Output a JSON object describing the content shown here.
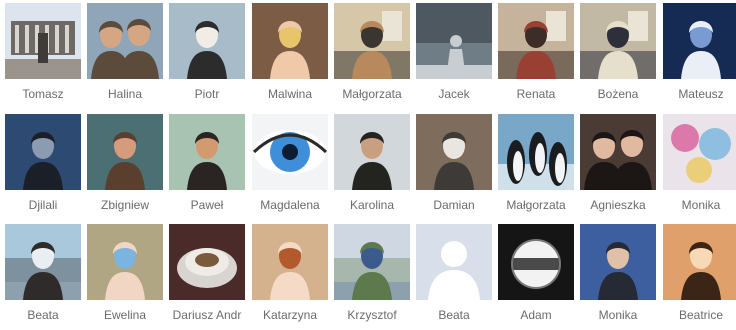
{
  "friends": [
    {
      "name": "Tomasz",
      "thumb": "monument-square",
      "colors": [
        "#dce4ee",
        "#6d6a66",
        "#3e3b38"
      ]
    },
    {
      "name": "Halina",
      "thumb": "couple-selfie",
      "colors": [
        "#8fa6b8",
        "#d5a684",
        "#5c4a3b"
      ]
    },
    {
      "name": "Piotr",
      "thumb": "man-sunglasses",
      "colors": [
        "#a7bcc8",
        "#f2ece6",
        "#2c2c2c"
      ]
    },
    {
      "name": "Malwina",
      "thumb": "blonde-woman",
      "colors": [
        "#7c5c45",
        "#e8c56d",
        "#f0c9a8"
      ]
    },
    {
      "name": "Małgorzata",
      "thumb": "woman-in-room",
      "colors": [
        "#d6c7a9",
        "#3a3530",
        "#b7895c"
      ]
    },
    {
      "name": "Jacek",
      "thumb": "silhouette-sky",
      "colors": [
        "#6f7d87",
        "#1d1f22",
        "#c8cdd1"
      ]
    },
    {
      "name": "Renata",
      "thumb": "woman-desk",
      "colors": [
        "#c6b39c",
        "#3c2d28",
        "#9a4032"
      ]
    },
    {
      "name": "Bożena",
      "thumb": "room-interior",
      "colors": [
        "#c2b9a4",
        "#2d2f3b",
        "#e5dfcc"
      ]
    },
    {
      "name": "Mateusz",
      "thumb": "blue-portrait",
      "colors": [
        "#162b54",
        "#7a9ad2",
        "#e9eef7"
      ]
    },
    {
      "name": "Djilali",
      "thumb": "man-blue-room",
      "colors": [
        "#2d4a72",
        "#8a9bb2",
        "#1a1f28"
      ]
    },
    {
      "name": "Zbigniew",
      "thumb": "man-face",
      "colors": [
        "#4b6f72",
        "#d49b7c",
        "#5b3f2e"
      ]
    },
    {
      "name": "Paweł",
      "thumb": "young-man",
      "colors": [
        "#a8c3b1",
        "#d3996f",
        "#2a2522"
      ]
    },
    {
      "name": "Magdalena",
      "thumb": "blue-eye",
      "colors": [
        "#f2f4f6",
        "#3f8ed8",
        "#0b1c33"
      ]
    },
    {
      "name": "Karolina",
      "thumb": "young-man-dark",
      "colors": [
        "#d2d7dc",
        "#c9a07f",
        "#23231f"
      ]
    },
    {
      "name": "Damian",
      "thumb": "man-striped-shirt",
      "colors": [
        "#7e6d5c",
        "#e9e6e1",
        "#3d3a37"
      ]
    },
    {
      "name": "Małgorzata",
      "thumb": "penguins",
      "colors": [
        "#78a7c8",
        "#1a1c1f",
        "#f2f4f5"
      ]
    },
    {
      "name": "Agnieszka",
      "thumb": "couple-dark",
      "colors": [
        "#4a3c35",
        "#e0b9a0",
        "#1c1614"
      ]
    },
    {
      "name": "Monika",
      "thumb": "colorful-drawing",
      "colors": [
        "#eae4ea",
        "#d74b8f",
        "#52a7d9"
      ]
    },
    {
      "name": "Beata",
      "thumb": "woman-by-water",
      "colors": [
        "#a9c8dc",
        "#e8eef2",
        "#2e2b2a"
      ]
    },
    {
      "name": "Ewelina",
      "thumb": "baby-cap",
      "colors": [
        "#b1a683",
        "#7bb4e0",
        "#f0d6c3"
      ]
    },
    {
      "name": "Dariusz Andr",
      "thumb": "cake-plate",
      "colors": [
        "#4b2a2a",
        "#d8d4cf",
        "#7a5a3d"
      ]
    },
    {
      "name": "Katarzyna",
      "thumb": "child-face",
      "colors": [
        "#d5b28e",
        "#b25a2d",
        "#f5dac6"
      ]
    },
    {
      "name": "Krzysztof",
      "thumb": "man-landscape",
      "colors": [
        "#cfd8e2",
        "#3c5b8d",
        "#5c7a4c"
      ]
    },
    {
      "name": "Beata",
      "thumb": "default-avatar",
      "colors": [
        "#d8dfea",
        "#ffffff",
        "#c1cbdd"
      ]
    },
    {
      "name": "Adam",
      "thumb": "dark-graphic",
      "colors": [
        "#151515",
        "#f2f2f2",
        "#4a4a4a"
      ]
    },
    {
      "name": "Monika",
      "thumb": "woman-pose",
      "colors": [
        "#3d5f9f",
        "#e0c0a6",
        "#262a35"
      ]
    },
    {
      "name": "Beatrice",
      "thumb": "woman-glow",
      "colors": [
        "#e0a06c",
        "#f7d9b5",
        "#3a2516"
      ]
    }
  ]
}
